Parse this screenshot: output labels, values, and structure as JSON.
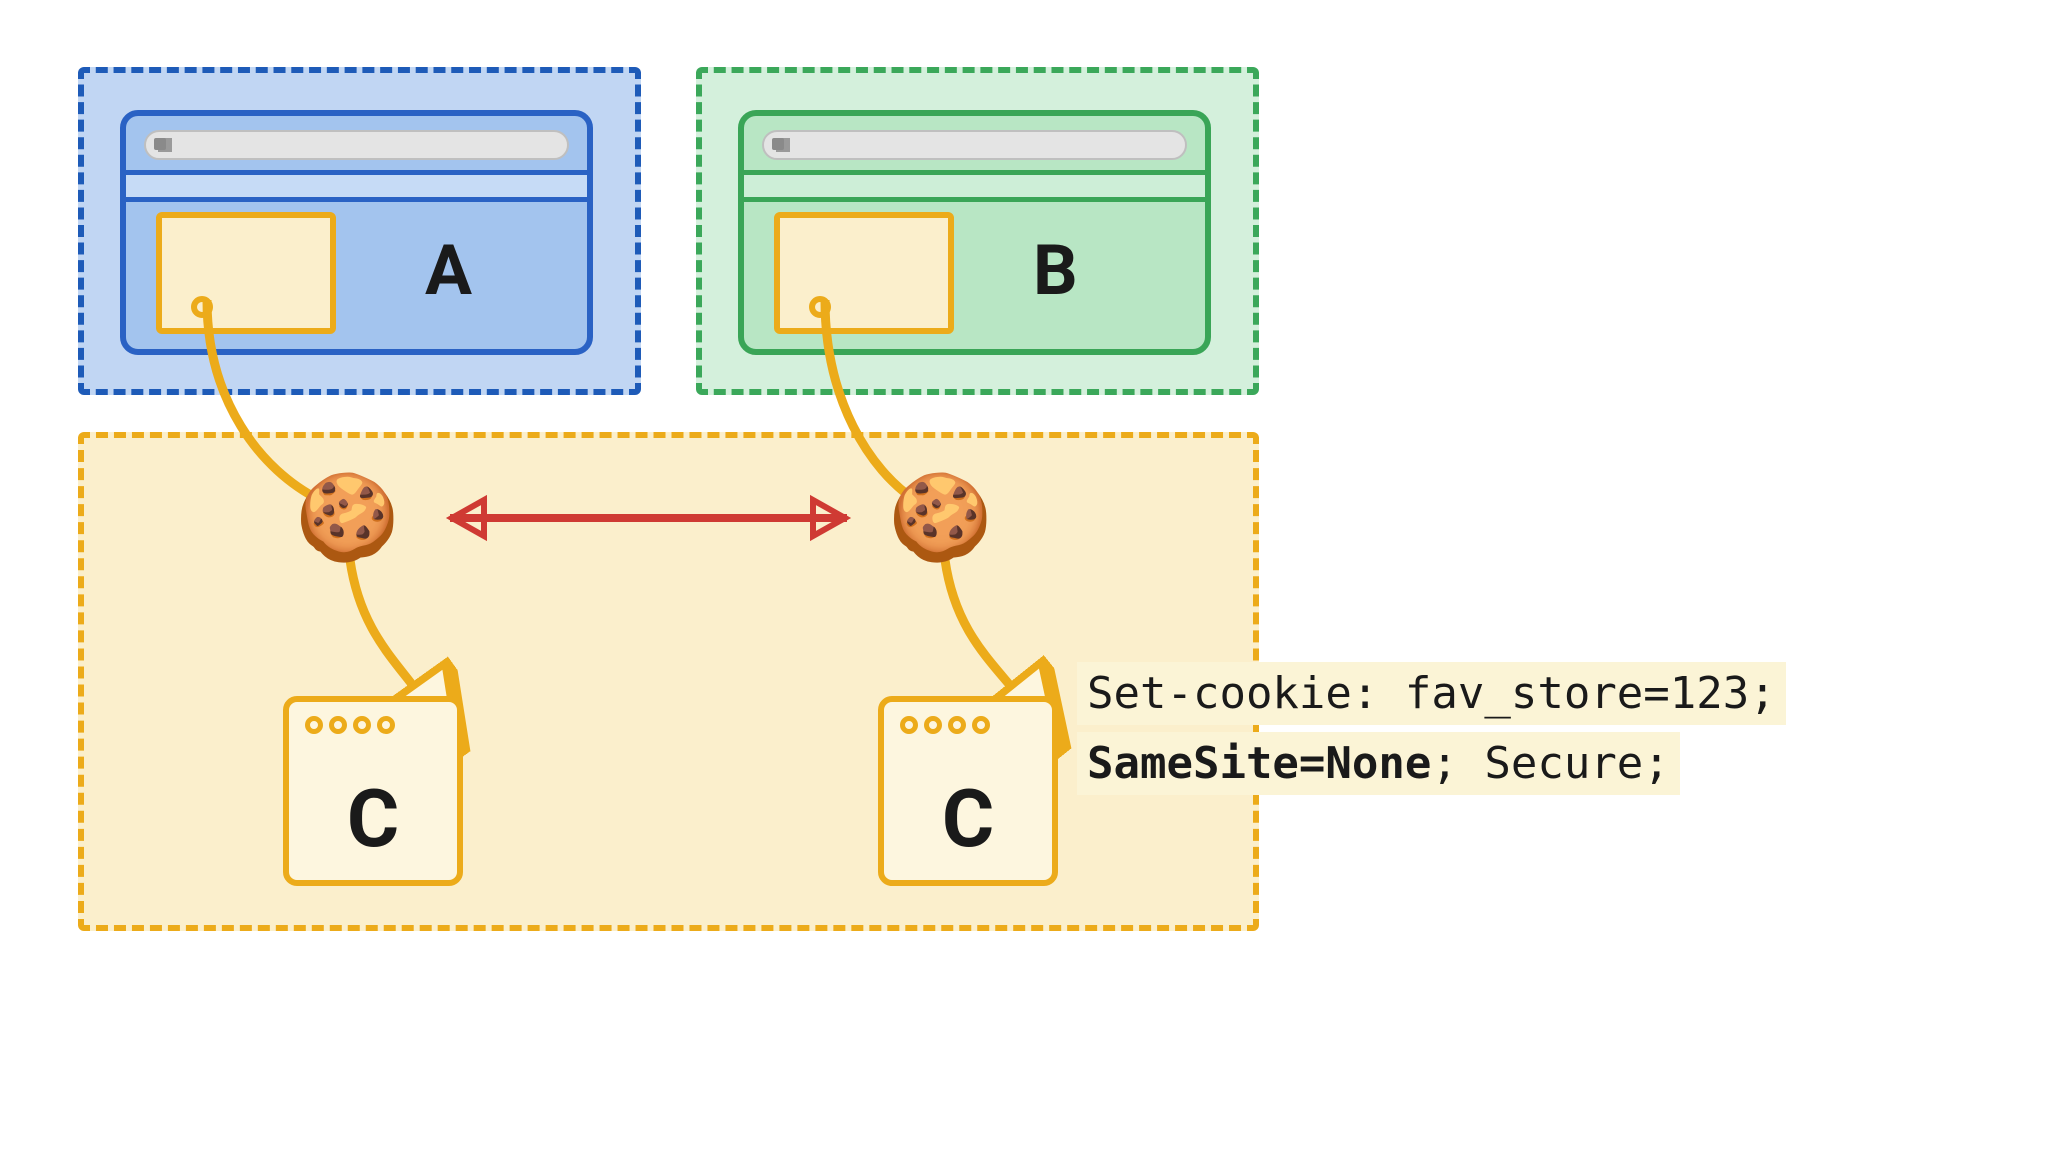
{
  "sites": {
    "a_label": "A",
    "b_label": "B",
    "c_label": "C"
  },
  "cookie_header": {
    "line1": "Set-cookie: fav_store=123;",
    "line2_bold": "SameSite=None",
    "line2_rest": "; Secure;"
  },
  "icons": {
    "cookie": "🍪"
  },
  "arrows": {
    "red_bi": "bidirectional",
    "flows": [
      "A-iframe -> cookie1 -> C1",
      "B-iframe -> cookie2 -> C2"
    ]
  },
  "colors": {
    "site_a_border": "#1e5bb8",
    "site_a_fill": "#c1d6f3",
    "site_b_border": "#3ba85a",
    "site_b_fill": "#d4f0dc",
    "site_c_border": "#ecab1a",
    "site_c_fill": "#fbefcc",
    "arrow_red": "#cf3a33",
    "connector": "#ecab1a"
  }
}
